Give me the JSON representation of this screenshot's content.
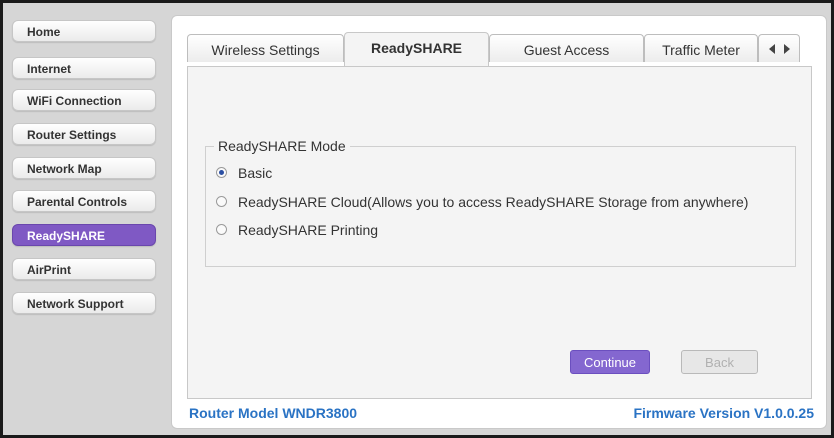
{
  "sidebar": {
    "items": [
      {
        "label": "Home",
        "active": false
      },
      {
        "label": "Internet",
        "active": false
      },
      {
        "label": "WiFi Connection",
        "active": false
      },
      {
        "label": "Router Settings",
        "active": false
      },
      {
        "label": "Network Map",
        "active": false
      },
      {
        "label": "Parental Controls",
        "active": false
      },
      {
        "label": "ReadySHARE",
        "active": true
      },
      {
        "label": "AirPrint",
        "active": false
      },
      {
        "label": "Network Support",
        "active": false
      }
    ]
  },
  "tabs": [
    {
      "label": "Wireless Settings",
      "active": false
    },
    {
      "label": "ReadySHARE",
      "active": true
    },
    {
      "label": "Guest Access",
      "active": false
    },
    {
      "label": "Traffic Meter",
      "active": false
    }
  ],
  "mode": {
    "legend": "ReadySHARE Mode",
    "options": [
      {
        "label": "Basic",
        "checked": true
      },
      {
        "label": "ReadySHARE Cloud(Allows you to access ReadySHARE Storage from anywhere)",
        "checked": false
      },
      {
        "label": "ReadySHARE Printing",
        "checked": false
      }
    ]
  },
  "buttons": {
    "continue_label": "Continue",
    "back_label": "Back"
  },
  "footer": {
    "model": "Router Model WNDR3800",
    "firmware": "Firmware Version V1.0.0.25"
  },
  "colors": {
    "accent": "#7f59c4",
    "footer_text": "#2a73c4"
  }
}
